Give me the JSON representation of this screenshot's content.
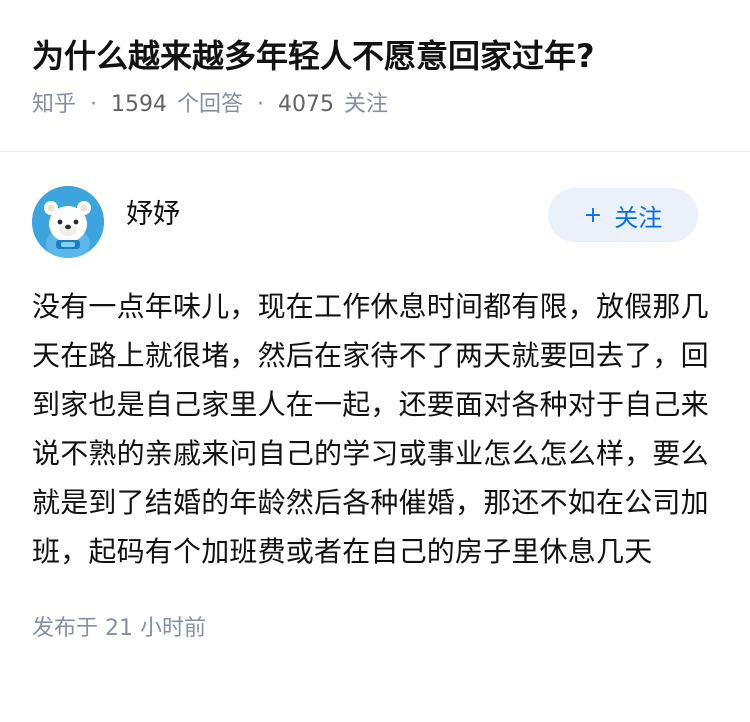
{
  "question": {
    "title": "为什么越来越多年轻人不愿意回家过年?",
    "source": "知乎",
    "answer_count": "1594",
    "answer_label": "个回答",
    "follower_count": "4075",
    "follower_label": "关注",
    "separator": "·"
  },
  "answer": {
    "author": {
      "name": "妤妤",
      "avatar_icon": "bear-avatar-icon"
    },
    "follow_button": {
      "plus": "+",
      "label": "关注"
    },
    "content": "没有一点年味儿，现在工作休息时间都有限，放假那几天在路上就很堵，然后在家待不了两天就要回去了，回到家也是自己家里人在一起，还要面对各种对于自己来说不熟的亲戚来问自己的学习或事业怎么怎么样，要么就是到了结婚的年龄然后各种催婚，那还不如在公司加班，起码有个加班费或者在自己的房子里休息几天",
    "published_label": "发布于",
    "published_time": "21 小时前"
  },
  "colors": {
    "accent": "#056de8",
    "follow_bg": "#ebf1fa",
    "meta": "#8590a6",
    "avatar_bg": "#3ea4de"
  }
}
